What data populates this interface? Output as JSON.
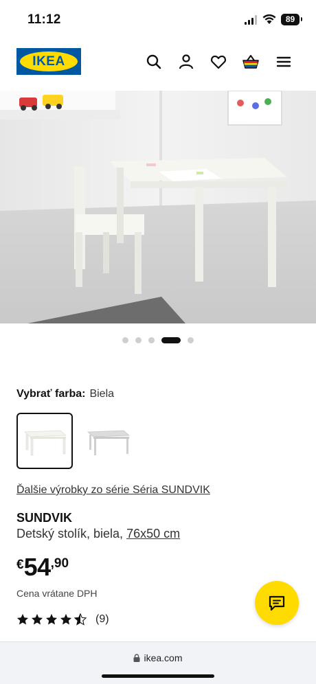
{
  "status_bar": {
    "time": "11:12",
    "battery": "89"
  },
  "header": {
    "logo_text": "IKEA",
    "icons": [
      "search-icon",
      "user-icon",
      "heart-icon",
      "basket-icon",
      "menu-icon"
    ]
  },
  "gallery": {
    "dot_count": 5,
    "active_index": 3
  },
  "color_select": {
    "label": "Vybrať farba:",
    "value": "Biela"
  },
  "series_link": "Ďalšie výrobky zo série Séria SUNDVIK",
  "product": {
    "name": "SUNDVIK",
    "description": "Detský stolík, biela,",
    "dimensions": "76x50 cm"
  },
  "price": {
    "currency": "€",
    "integer": "54",
    "decimal": ",90",
    "note": "Cena vrátane DPH"
  },
  "rating": {
    "stars": 4.5,
    "count": "(9)"
  },
  "browser": {
    "url": "ikea.com"
  },
  "colors": {
    "ikea_blue": "#0058a3",
    "ikea_yellow": "#ffdb00"
  }
}
